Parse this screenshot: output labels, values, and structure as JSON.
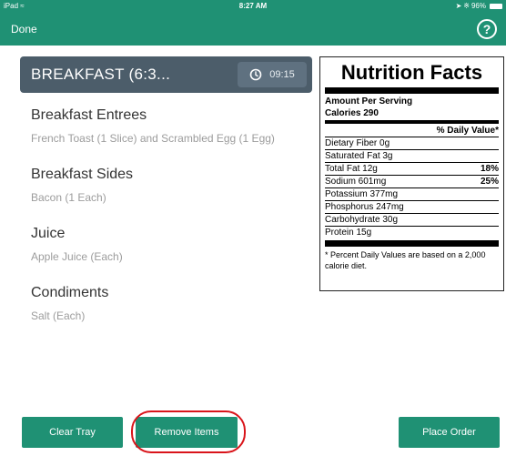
{
  "status_bar": {
    "device": "iPad",
    "time": "8:27 AM",
    "battery": "96%"
  },
  "nav": {
    "done_label": "Done",
    "help_label": "?"
  },
  "meal": {
    "title": "BREAKFAST (6:3...",
    "time": "09:15"
  },
  "menu": [
    {
      "category": "Breakfast Entrees",
      "item": "French Toast (1 Slice) and Scrambled Egg (1 Egg)"
    },
    {
      "category": "Breakfast Sides",
      "item": "Bacon (1 Each)"
    },
    {
      "category": "Juice",
      "item": "Apple Juice (Each)"
    },
    {
      "category": "Condiments",
      "item": "Salt (Each)"
    }
  ],
  "nutrition": {
    "title": "Nutrition Facts",
    "amount_per_serving": "Amount Per Serving",
    "calories": "Calories 290",
    "daily_value_header": "% Daily Value*",
    "rows": [
      {
        "label": "Dietary Fiber 0g",
        "dv": ""
      },
      {
        "label": "Saturated Fat 3g",
        "dv": ""
      },
      {
        "label": "Total Fat 12g",
        "dv": "18%"
      },
      {
        "label": "Sodium 601mg",
        "dv": "25%"
      },
      {
        "label": "Potassium 377mg",
        "dv": ""
      },
      {
        "label": "Phosphorus 247mg",
        "dv": ""
      },
      {
        "label": "Carbohydrate 30g",
        "dv": ""
      },
      {
        "label": "Protein 15g",
        "dv": ""
      }
    ],
    "footnote": "* Percent Daily Values are based on a 2,000 calorie diet."
  },
  "buttons": {
    "clear_tray": "Clear Tray",
    "remove_items": "Remove Items",
    "place_order": "Place Order"
  },
  "colors": {
    "brand_green": "#1f9174",
    "meal_header": "#4c5d6a",
    "highlight_ring": "#d9141a"
  }
}
